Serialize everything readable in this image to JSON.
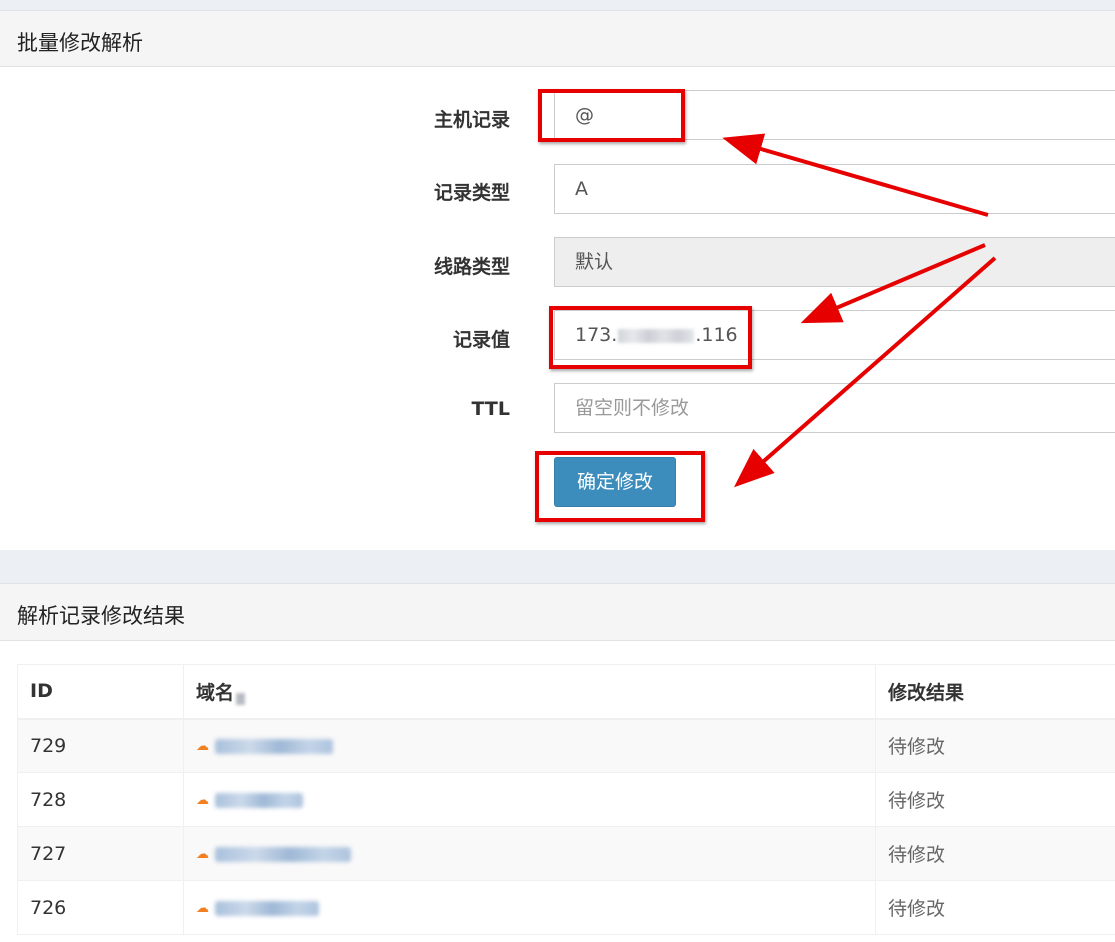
{
  "form_panel": {
    "title": "批量修改解析",
    "host_record": {
      "label": "主机记录",
      "value": "@"
    },
    "record_type": {
      "label": "记录类型",
      "value": "A"
    },
    "line_type": {
      "label": "线路类型",
      "value": "默认"
    },
    "record_value": {
      "label": "记录值",
      "prefix": "173.",
      "suffix": ".116"
    },
    "ttl": {
      "label": "TTL",
      "placeholder": "留空则不修改"
    },
    "submit_label": "确定修改"
  },
  "results_panel": {
    "title": "解析记录修改结果",
    "columns": {
      "id": "ID",
      "domain": "域名",
      "result": "修改结果"
    },
    "rows": [
      {
        "id": "729",
        "result": "待修改"
      },
      {
        "id": "728",
        "result": "待修改"
      },
      {
        "id": "727",
        "result": "待修改"
      },
      {
        "id": "726",
        "result": "待修改"
      }
    ]
  },
  "colors": {
    "accent": "#3c8dbc",
    "annotation_red": "#e60000",
    "cloudflare_orange": "#f38020"
  },
  "icons": {
    "row_icon": "cloudflare-cloud-icon"
  }
}
